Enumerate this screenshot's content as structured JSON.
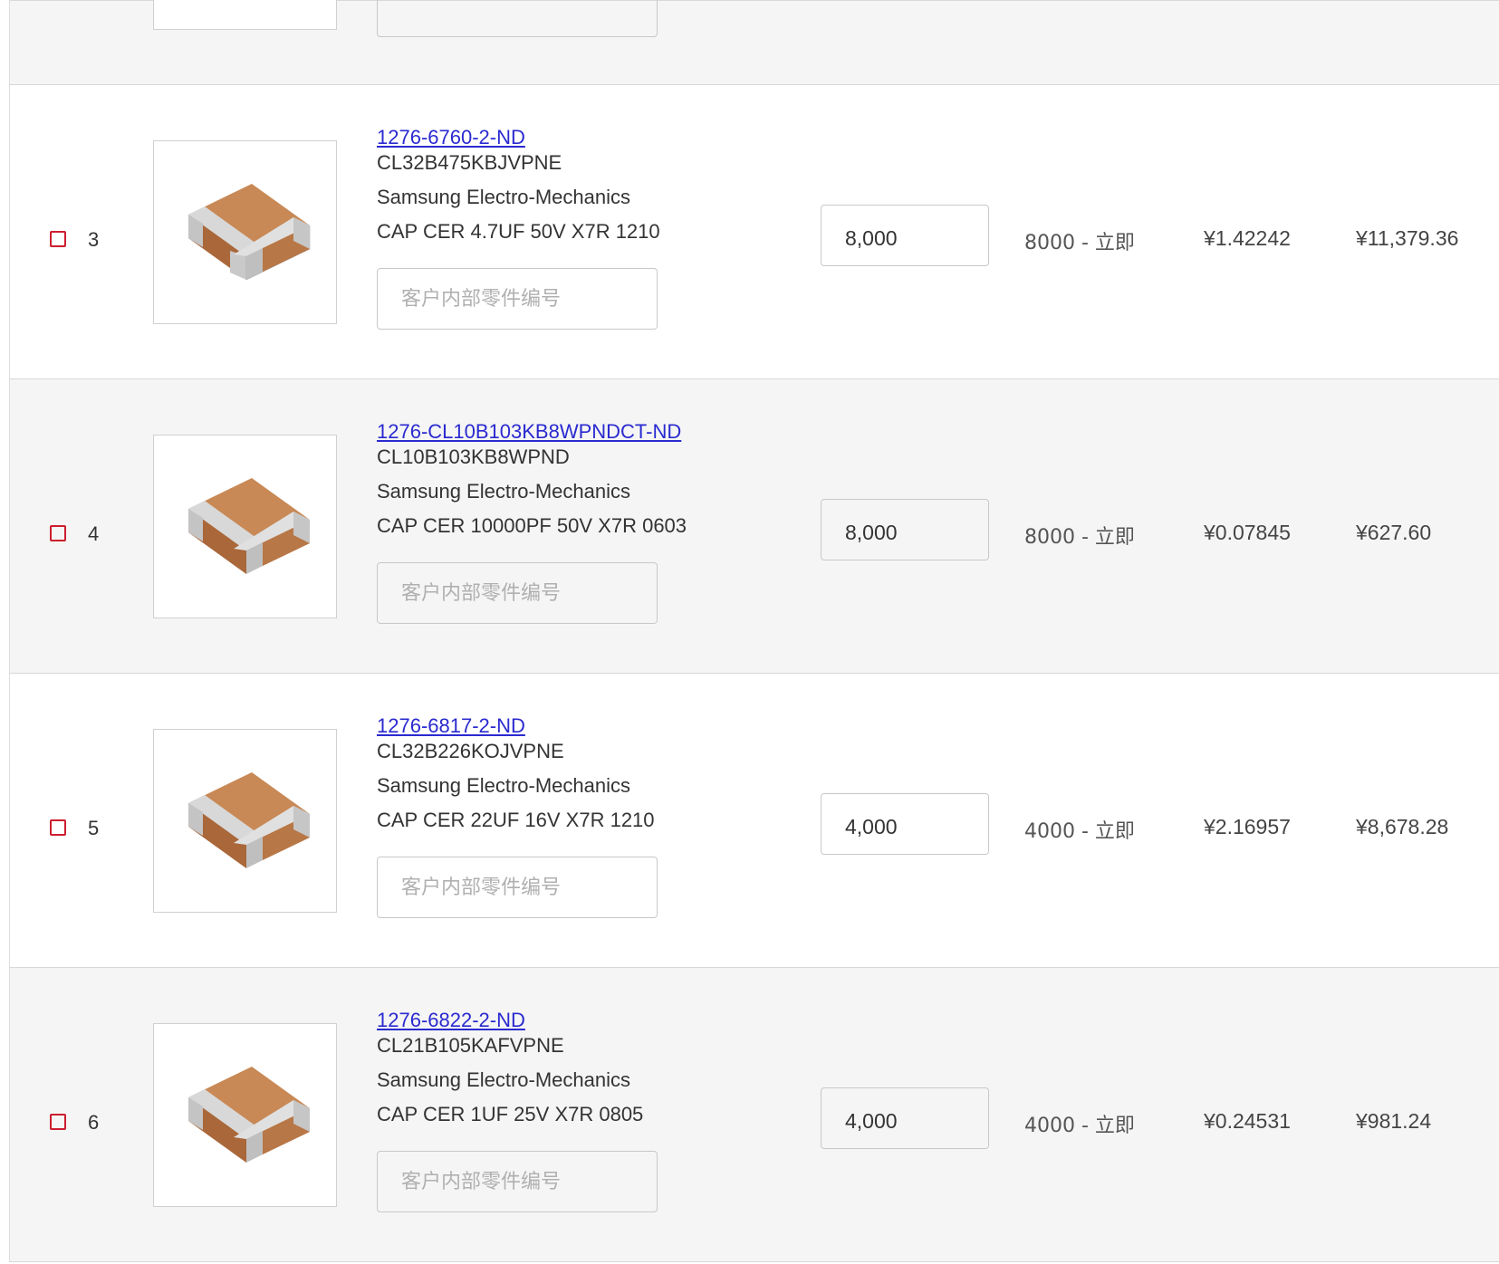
{
  "customer_part_placeholder": "客户内部零件编号",
  "rows": [
    {
      "num": "3",
      "digikey_part": "1276-6760-2-ND",
      "mfr_part": "CL32B475KBJVPNE",
      "manufacturer": "Samsung Electro-Mechanics",
      "description": "CAP CER 4.7UF 50V X7R 1210",
      "quantity": "8,000",
      "availability": "8000 - 立即",
      "unit_price": "¥1.42242",
      "extended_price": "¥11,379.36"
    },
    {
      "num": "4",
      "digikey_part": "1276-CL10B103KB8WPNDCT-ND",
      "mfr_part": "CL10B103KB8WPND",
      "manufacturer": "Samsung Electro-Mechanics",
      "description": "CAP CER 10000PF 50V X7R 0603",
      "quantity": "8,000",
      "availability": "8000 - 立即",
      "unit_price": "¥0.07845",
      "extended_price": "¥627.60"
    },
    {
      "num": "5",
      "digikey_part": "1276-6817-2-ND",
      "mfr_part": "CL32B226KOJVPNE",
      "manufacturer": "Samsung Electro-Mechanics",
      "description": "CAP CER 22UF 16V X7R 1210",
      "quantity": "4,000",
      "availability": "4000 - 立即",
      "unit_price": "¥2.16957",
      "extended_price": "¥8,678.28"
    },
    {
      "num": "6",
      "digikey_part": "1276-6822-2-ND",
      "mfr_part": "CL21B105KAFVPNE",
      "manufacturer": "Samsung Electro-Mechanics",
      "description": "CAP CER 1UF 25V X7R 0805",
      "quantity": "4,000",
      "availability": "4000 - 立即",
      "unit_price": "¥0.24531",
      "extended_price": "¥981.24"
    }
  ],
  "colors": {
    "checkbox_border": "#cc1e2e",
    "link": "#2a2ad0",
    "row_alt_bg": "#f5f5f5"
  },
  "icons": {
    "product_image": "mlcc-capacitor-icon"
  }
}
